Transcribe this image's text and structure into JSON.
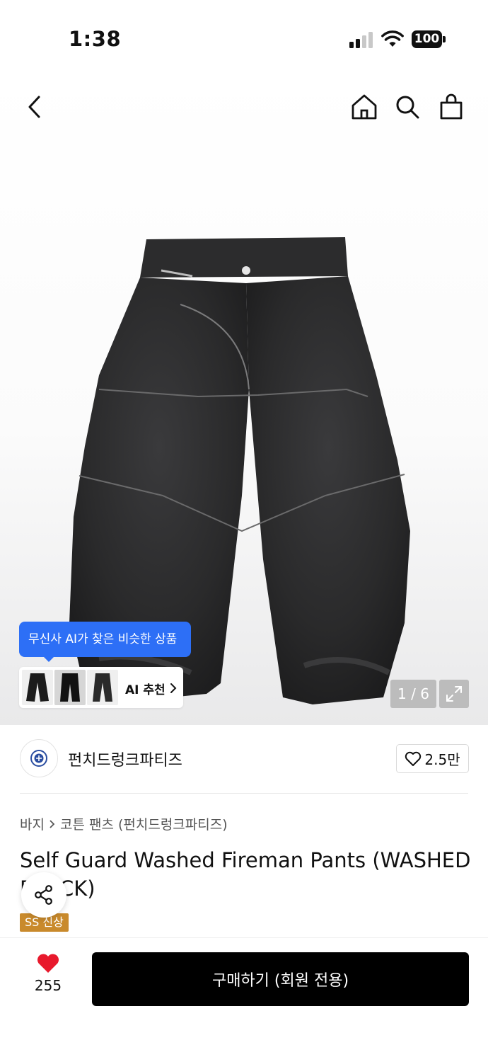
{
  "status": {
    "time": "1:38",
    "battery": "100"
  },
  "icons": {
    "back": "chevron-left-icon",
    "home": "home-icon",
    "search": "search-icon",
    "bag": "shopping-bag-icon",
    "share": "share-icon",
    "heart": "heart-icon",
    "expand": "expand-icon"
  },
  "gallery": {
    "current": "1",
    "total": "6",
    "counter_text": "1 / 6",
    "ai_tooltip": "무신사 AI가 찾은 비슷한 상품",
    "ai_label": "AI 추천"
  },
  "brand": {
    "name": "펀치드렁크파티즈",
    "likes": "2.5만"
  },
  "breadcrumb": {
    "category": "바지",
    "subcategory": "코튼 팬츠 (펀치드렁크파티즈)"
  },
  "product": {
    "title": "Self Guard Washed Fireman Pants (WASHED BLACK)",
    "badge": "SS 신상"
  },
  "bottom": {
    "wish_count": "255",
    "buy_label": "구매하기 (회원 전용)"
  },
  "colors": {
    "accent_blue": "#2d6ff6",
    "badge": "#c98a2c",
    "heart": "#e8192c",
    "button": "#000000"
  }
}
